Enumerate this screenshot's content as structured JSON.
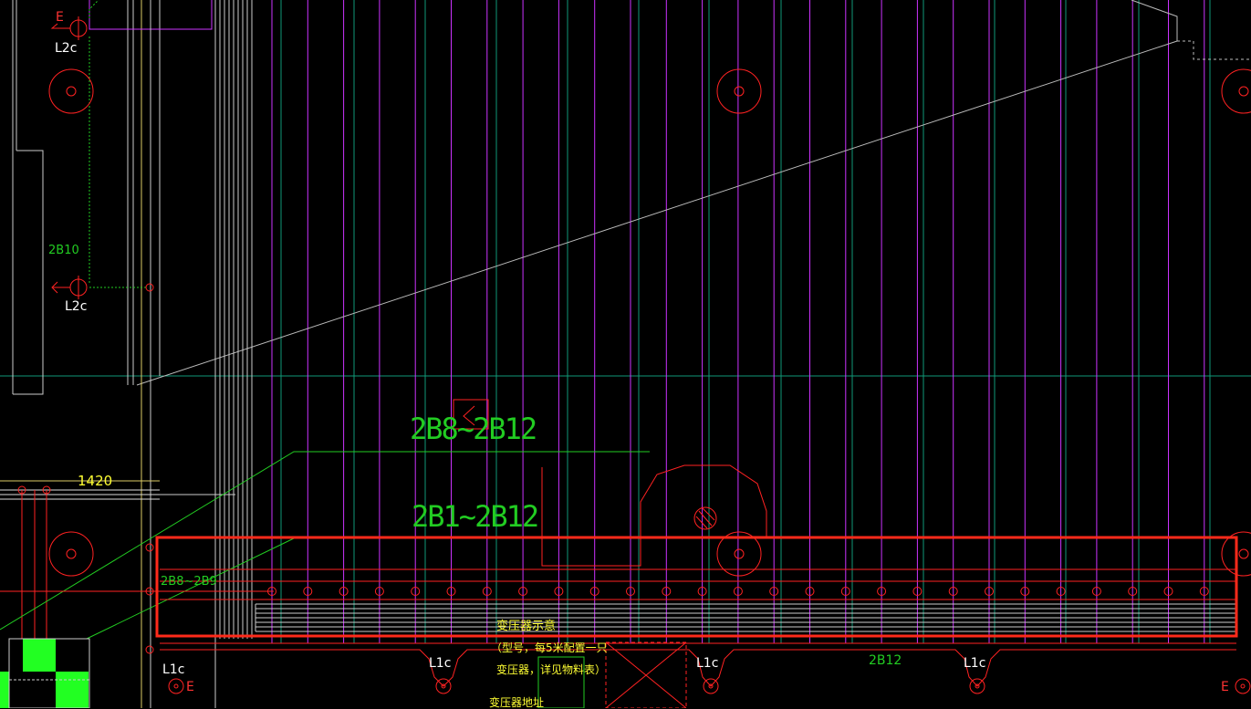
{
  "colors": {
    "background": "#000000",
    "magenta": "#cc33ff",
    "red": "#ff2222",
    "green": "#22cc22",
    "teal": "#119977",
    "yellow": "#ffff33",
    "white": "#ffffff",
    "grey": "#aaaaaa",
    "highlight": "#ff2a1a",
    "lime_fill": "#22ff22"
  },
  "labels": {
    "e_top": "E",
    "l2c_top": "L2c",
    "b10": "2B10",
    "l2c_mid": "L2c",
    "dim_1420": "1420",
    "b8_b12": "2B8~2B12",
    "b1_b12": "2B1~2B12",
    "b8_b9": "2B8~2B9",
    "transformer_title": "变压器示意",
    "transformer_note1": "（型号，每5米配置一只",
    "transformer_note2": "变压器，详见物料表）",
    "transformer_note3": "变压器地址",
    "l1c_1": "L1c",
    "l1c_2": "L1c",
    "l1c_3": "L1c",
    "l1c_4": "L1c",
    "b12": "2B12",
    "e_bottom_left": "E",
    "e_bottom_right": "E"
  }
}
